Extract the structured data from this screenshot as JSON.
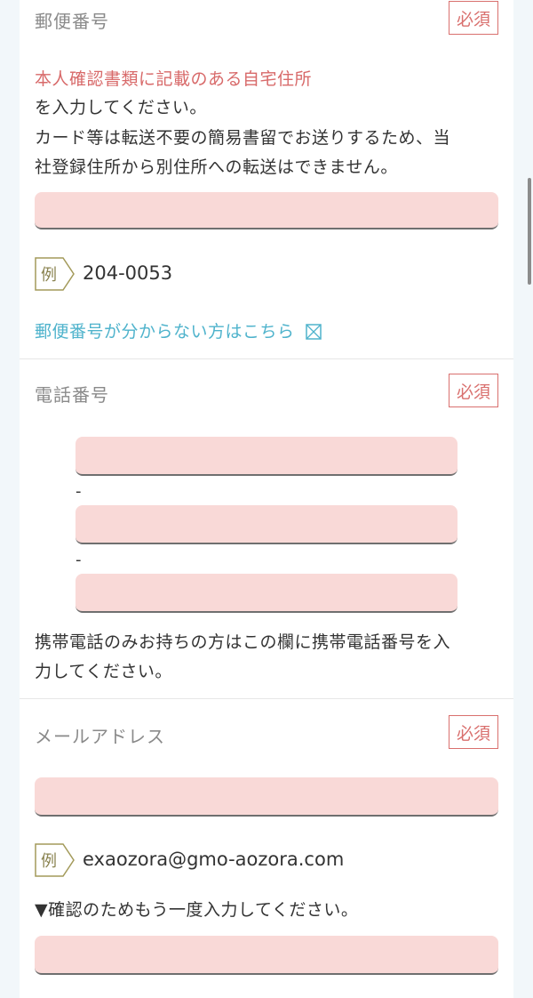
{
  "postal": {
    "label": "郵便番号",
    "required": "必須",
    "note_red": "本人確認書類に記載のある自宅住所",
    "note_line2": "を入力してください。",
    "note_line3": "カード等は転送不要の簡易書留でお送りするため、当",
    "note_line4": "社登録住所から別住所への転送はできません。",
    "example_tag": "例",
    "example_value": "204-0053",
    "lookup_link": "郵便番号が分からない方はこちら"
  },
  "phone": {
    "label": "電話番号",
    "required": "必須",
    "separator": "-",
    "note_line1": "携帯電話のみお持ちの方はこの欄に携帯電話番号を入",
    "note_line2": "力してください。"
  },
  "email": {
    "label": "メールアドレス",
    "required": "必須",
    "example_tag": "例",
    "example_value": "exaozora@gmo-aozora.com",
    "confirm_note": "▼確認のためもう一度入力してください。"
  },
  "colors": {
    "accent_red": "#d86a6a",
    "input_bg": "#f9d9d7",
    "link": "#4fb3cc"
  }
}
